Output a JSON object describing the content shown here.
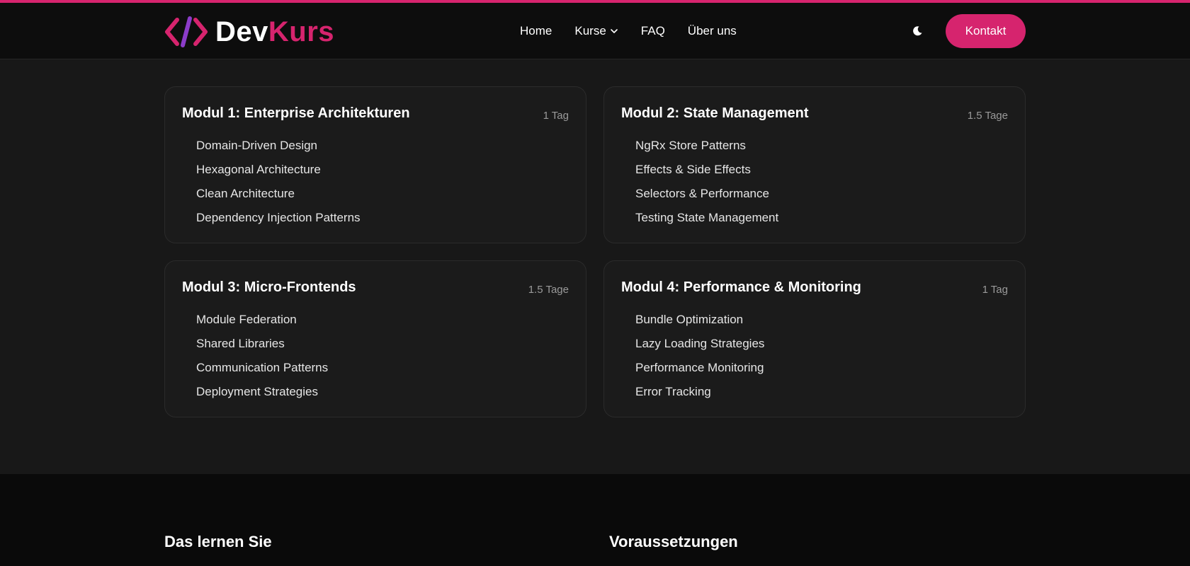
{
  "brand": {
    "name_part1": "Dev",
    "name_part2": "Kurs",
    "accent_color": "#d6246e",
    "secondary_color": "#8b3cc8",
    "icon": "code-brackets-icon"
  },
  "nav": {
    "items": [
      {
        "label": "Home"
      },
      {
        "label": "Kurse",
        "icon": "chevron-down-icon"
      },
      {
        "label": "FAQ"
      },
      {
        "label": "Über uns"
      }
    ],
    "theme_icon": "moon-icon",
    "contact_label": "Kontakt"
  },
  "modules": [
    {
      "title": "Modul 1: Enterprise Architekturen",
      "duration": "1 Tag",
      "topics": [
        "Domain-Driven Design",
        "Hexagonal Architecture",
        "Clean Architecture",
        "Dependency Injection Patterns"
      ]
    },
    {
      "title": "Modul 2: State Management",
      "duration": "1.5 Tage",
      "topics": [
        "NgRx Store Patterns",
        "Effects & Side Effects",
        "Selectors & Performance",
        "Testing State Management"
      ]
    },
    {
      "title": "Modul 3: Micro-Frontends",
      "duration": "1.5 Tage",
      "topics": [
        "Module Federation",
        "Shared Libraries",
        "Communication Patterns",
        "Deployment Strategies"
      ]
    },
    {
      "title": "Modul 4: Performance & Monitoring",
      "duration": "1 Tag",
      "topics": [
        "Bundle Optimization",
        "Lazy Loading Strategies",
        "Performance Monitoring",
        "Error Tracking"
      ]
    }
  ],
  "sections": {
    "learn_title": "Das lernen Sie",
    "requirements_title": "Voraussetzungen"
  }
}
